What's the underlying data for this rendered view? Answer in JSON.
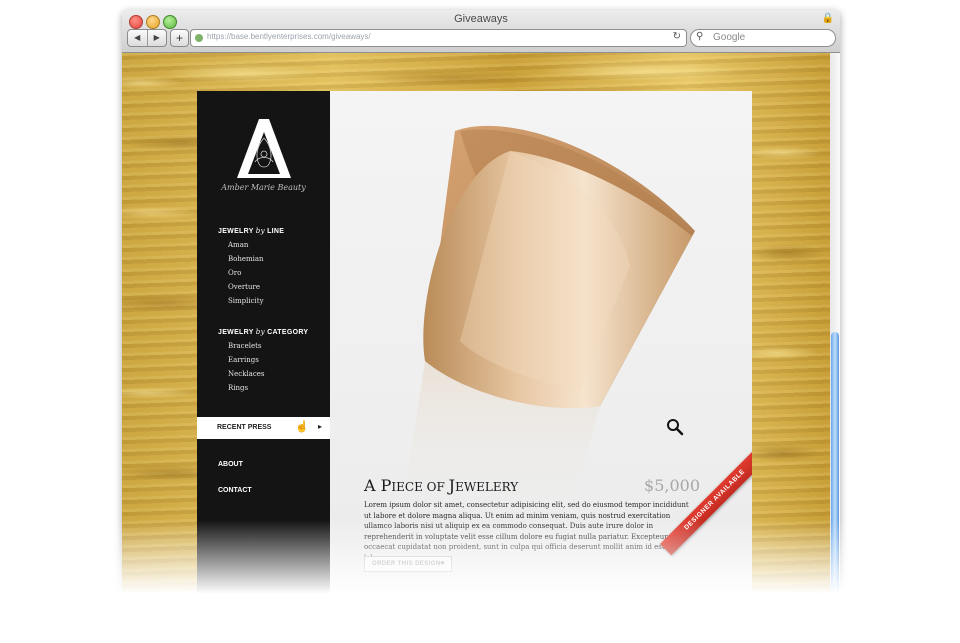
{
  "browser": {
    "window_title": "Giveaways",
    "url": "https://base.bentlyenterprises.com/giveaways/",
    "search_placeholder": "Google",
    "back_glyph": "◀",
    "forward_glyph": "▶",
    "add_glyph": "+",
    "reload_glyph": "↻",
    "search_glyph": "⚲",
    "lock_glyph": "🔒"
  },
  "brand": {
    "signature": "Amber Marie Beauty",
    "logo_letter": "A"
  },
  "nav": {
    "line_heading_pre": "JEWELRY ",
    "line_heading_by": "by",
    "line_heading_post": " LINE",
    "line_items": [
      "Aman",
      "Bohemian",
      "Oro",
      "Overture",
      "Simplicity"
    ],
    "category_heading_pre": "JEWELRY ",
    "category_heading_by": "by",
    "category_heading_post": " CATEGORY",
    "category_items": [
      "Bracelets",
      "Earrings",
      "Necklaces",
      "Rings"
    ],
    "recent_press": "RECENT PRESS",
    "recent_press_arrow": "▸",
    "about": "ABOUT",
    "contact": "CONTACT"
  },
  "product": {
    "title_first": "A P",
    "title_small1": "IECE OF ",
    "title_mid": "J",
    "title_small2": "EWELERY",
    "price": "$5,000",
    "description": "Lorem ipsum dolor sit amet, consectetur adipisicing elit, sed do eiusmod tempor incididunt ut labore et dolore magna aliqua. Ut enim ad minim veniam, quis nostrud exercitation ullamco laboris nisi ut aliquip ex ea commodo consequat. Duis aute irure dolor in reprehenderit in voluptate velit esse cillum dolore eu fugiat nulla pariatur. Excepteur sint occaecat cupidatat non proident, sunt in culpa qui officia deserunt mollit anim id est laborum.",
    "order_button": "ORDER THIS DESIGN",
    "order_arrow": "➜",
    "ribbon": "DESIGNER AVAILABLE"
  },
  "colors": {
    "sidebar_bg": "#141414",
    "ribbon": "#d23127",
    "gold": "#d2ad4a"
  }
}
